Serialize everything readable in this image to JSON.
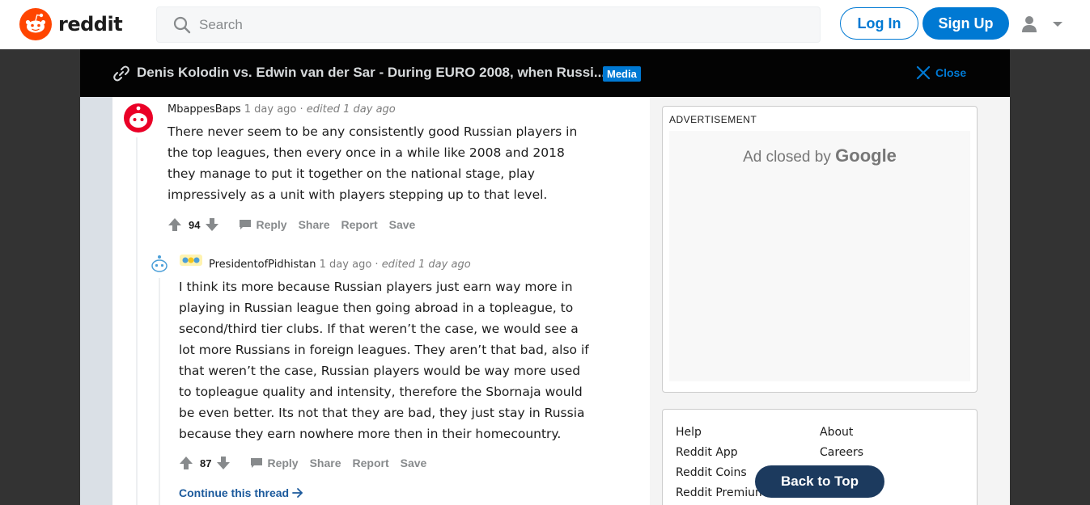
{
  "header": {
    "logo_text": "reddit",
    "search_placeholder": "Search",
    "login_label": "Log In",
    "signup_label": "Sign Up"
  },
  "post": {
    "title": "Denis Kolodin vs. Edwin van der Sar - During EURO 2008, when Russi...",
    "badge": "Media",
    "close_label": "Close"
  },
  "comments": [
    {
      "author": "MbappesBaps",
      "time": "1 day ago",
      "edited": "edited 1 day ago",
      "body_lines": [
        "There never seem to be any consistently good Russian players in",
        "the top leagues, then every once in a while like 2008 and 2018",
        "they manage to put it together on the national stage, play",
        "impressively as a unit with players stepping up to that level."
      ],
      "votes": "94",
      "actions": [
        "Reply",
        "Share",
        "Report",
        "Save"
      ]
    },
    {
      "author": "PresidentofPidhistan",
      "time": "1 day ago",
      "edited": "edited 1 day ago",
      "body_lines": [
        "I think its more because Russian players just earn way more in",
        "playing in Russian league then going abroad in a topleague, to",
        "second/third tier clubs. If that weren’t the case, we would see a",
        "lot more Russians in foreign leagues. They aren’t that bad, also if",
        "that weren’t the case, Russian players would be way more used",
        "to topleague quality and intensity, therefore the Sbornaja would",
        "be even better. Its not that they are bad, they just stay in Russia",
        "because they earn nowhere more then in their homecountry."
      ],
      "votes": "87",
      "actions": [
        "Reply",
        "Share",
        "Report",
        "Save"
      ]
    }
  ],
  "continue_label": "Continue this thread",
  "sidebar": {
    "ad_label": "ADVERTISEMENT",
    "ad_closed_text": "Ad closed by",
    "ad_closed_brand": "Google",
    "links_col1": [
      "Help",
      "Reddit App",
      "Reddit Coins",
      "Reddit Premium"
    ],
    "links_col2": [
      "About",
      "Careers"
    ],
    "back_to_top": "Back to Top"
  },
  "colors": {
    "brand_orange": "#ff4500",
    "accent_blue": "#0079d3",
    "dark_bar": "#030303"
  }
}
